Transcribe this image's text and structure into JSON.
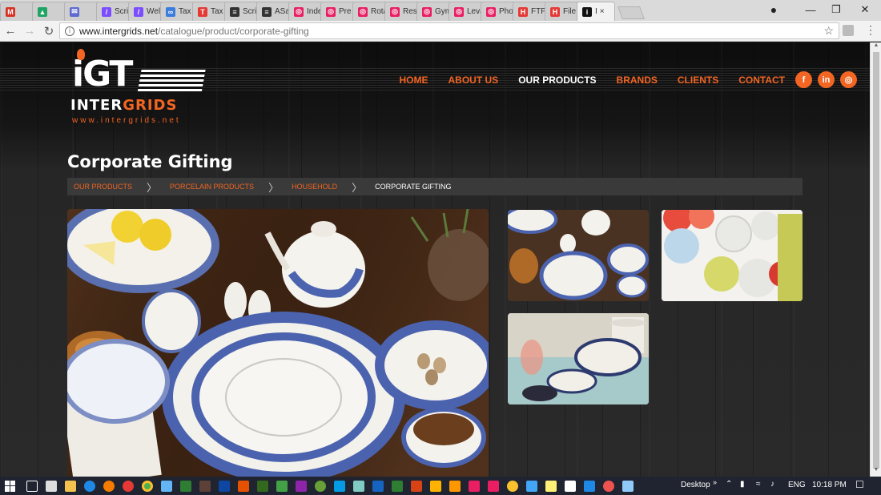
{
  "browser": {
    "tabs": [
      {
        "label": "",
        "color": "#d93025",
        "glyph": "M"
      },
      {
        "label": "",
        "color": "#1fa463",
        "glyph": "▲"
      },
      {
        "label": "",
        "color": "#5e6ad2",
        "glyph": "✉"
      },
      {
        "label": "Scri",
        "color": "#7c4dff",
        "glyph": "/"
      },
      {
        "label": "Wel",
        "color": "#7c4dff",
        "glyph": "/"
      },
      {
        "label": "Tax",
        "color": "#3b7ddd",
        "glyph": "∞"
      },
      {
        "label": "Tax",
        "color": "#e53935",
        "glyph": "T"
      },
      {
        "label": "Scri",
        "color": "#333333",
        "glyph": "≡"
      },
      {
        "label": "ASa",
        "color": "#333333",
        "glyph": "≡"
      },
      {
        "label": "Inde",
        "color": "#e91e63",
        "glyph": "◎"
      },
      {
        "label": "Pre",
        "color": "#e91e63",
        "glyph": "◎"
      },
      {
        "label": "Rota",
        "color": "#e91e63",
        "glyph": "◎"
      },
      {
        "label": "Rest",
        "color": "#e91e63",
        "glyph": "◎"
      },
      {
        "label": "Gym",
        "color": "#e91e63",
        "glyph": "◎"
      },
      {
        "label": "Leva",
        "color": "#e91e63",
        "glyph": "◎"
      },
      {
        "label": "Pho",
        "color": "#e91e63",
        "glyph": "◎"
      },
      {
        "label": "FTP",
        "color": "#e53935",
        "glyph": "H"
      },
      {
        "label": "File",
        "color": "#e53935",
        "glyph": "H"
      },
      {
        "label": "I",
        "color": "#111111",
        "glyph": "i"
      }
    ],
    "url_host": "www.intergrids.net",
    "url_path": "/catalogue/product/corporate-gifting",
    "active_tab_close": "×"
  },
  "logo": {
    "letters": "iGT",
    "name_a": "INTER",
    "name_b": "GRIDS",
    "website": "www.intergrids.net"
  },
  "nav": {
    "items": [
      {
        "label": "HOME",
        "active": false
      },
      {
        "label": "ABOUT US",
        "active": false
      },
      {
        "label": "OUR PRODUCTS",
        "active": true
      },
      {
        "label": "BRANDS",
        "active": false
      },
      {
        "label": "CLIENTS",
        "active": false
      },
      {
        "label": "CONTACT",
        "active": false
      }
    ],
    "social": [
      "f",
      "in",
      "◎"
    ]
  },
  "page": {
    "title": "Corporate Gifting",
    "breadcrumb": [
      "OUR PRODUCTS",
      "PORCELAIN PRODUCTS",
      "HOUSEHOLD",
      "CORPORATE GIFTING"
    ],
    "separator": "〉"
  },
  "taskbar": {
    "desktop_label": "Desktop",
    "language": "ENG",
    "time": "10:18 PM"
  },
  "colors": {
    "accent": "#f26522",
    "breadcrumb_bg": "#3a3a3a"
  }
}
